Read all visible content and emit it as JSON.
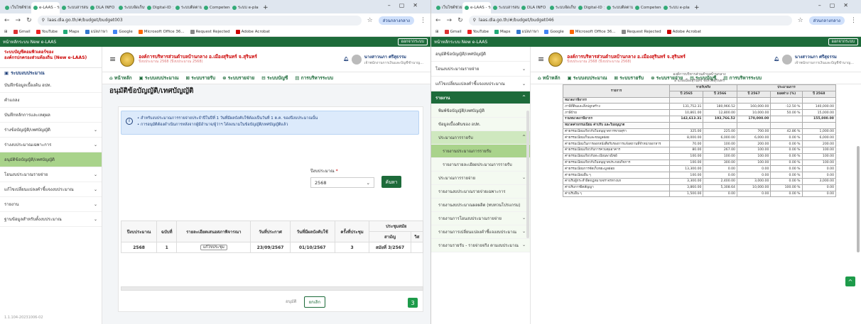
{
  "left": {
    "tabs": [
      "เว็บไซต์ช่วยใ",
      "e-LAAS - ระบบ",
      "ระบบสารสนเทศ",
      "DLA INFO",
      "ระบบจัดเก็บข้",
      "Digital-ID",
      "ระบบติดตามผล",
      "Competency",
      "ระบบ e-plan"
    ],
    "url": "laas.dla.go.th/#/budget/budget003",
    "profile": "ส่วนกลางกลาง",
    "bookmarks": [
      "Gmail",
      "YouTube",
      "Maps",
      "แปลภาษา",
      "Google",
      "Microsoft Office 36...",
      "Request Rejected",
      "Adobe Acrobat"
    ],
    "topbar_title": "หน้าหลักระบบ New e-LAAS",
    "logout": "ออกจากระบบ",
    "brand_line1": "ระบบบัญชีคอมพิวเตอร์ของ",
    "brand_line2": "องค์กรปกครองส่วนท้องถิ่น (New e-LAAS)",
    "menu_head": "ระบบงบประมาณ",
    "menu": [
      {
        "label": "บันทึกข้อมูลเบื้องต้น อปท.",
        "arrow": ""
      },
      {
        "label": "คำแถลง",
        "arrow": ""
      },
      {
        "label": "บันทึกหลักการและเหตุผล",
        "arrow": ""
      },
      {
        "label": "ร่างข้อบัญญัติ/เทศบัญญัติ",
        "arrow": "⌄"
      },
      {
        "label": "ร่างงบประมาณเฉพาะการ",
        "arrow": "⌄"
      },
      {
        "label": "อนุมัติข้อบัญญัติ/เทศบัญญัติ",
        "arrow": ""
      },
      {
        "label": "โอนงบประมาณรายจ่าย",
        "arrow": "⌄"
      },
      {
        "label": "แก้ไขเปลี่ยนแปลงคำชี้แจงงบประมาณ",
        "arrow": "⌄"
      },
      {
        "label": "รายงาน",
        "arrow": "⌄"
      },
      {
        "label": "ฐานข้อมูลสำหรับตั้งงบประมาณ",
        "arrow": "⌄"
      }
    ],
    "version": "1.1.104-20231006-02",
    "org_name": "องค์การบริหารส่วนตำบลบ้านกลาง อ.เมืองสุรินทร์ จ.สุรินทร์",
    "org_sub": "ปีงบประมาณ 2568 (ปีงบประมาณ 2568)",
    "user_name": "นางสาวนภา ศรีสุธรรม",
    "user_role": "เจ้าพนักงานการเงินและบัญชีชำนาญ...",
    "nav": [
      "หน้าหลัก",
      "ระบบงบประมาณ",
      "ระบบรายรับ",
      "ระบบรายจ่าย",
      "ระบบบัญชี",
      "การบริหารระบบ"
    ],
    "page_title": "อนุมัติข้อบัญญัติ/เทศบัญญัติ",
    "info1": "• สำหรับงบประมาณการรายจ่ายประจำปีในปีที่ 1 วันที่มีผลบังคับใช้ต้องเป็นวันที่ 1 ต.ค. ของปีงบประมาณนั้น",
    "info2": "• การอนุมัติต้องดำเนินการหลังจากผู้มีอำนาจ/ผู้ว่าฯ ได้ลงนามในข้อบัญญัติ/เทศบัญญัติแล้ว",
    "year_label": "ปีงบประมาณ",
    "year_req": "*",
    "year_value": "2568",
    "search_btn": "ค้นหา",
    "table_headers": [
      "ปีงบประมาณ",
      "ฉบับที่",
      "รายละเอียดเสนอสภาพิจารณา",
      "วันที่ประกาศ",
      "วันที่มีผลบังคับใช้",
      "ครั้งที่ประชุม",
      "ประชุมสมัย",
      "สามัญ",
      "วิส"
    ],
    "table_row": [
      "2568",
      "1",
      "แก้ไขประชุม",
      "23/09/2567",
      "01/10/2567",
      "3",
      "สมัยที่ 3/2567"
    ],
    "btn_approve": "อนุมัติ",
    "btn_cancel": "ยกเลิก"
  },
  "right": {
    "url": "laas.dla.go.th/#/budget/budget046",
    "menu_top": [
      {
        "label": "อนุมัติข้อบัญญัติ/เทศบัญญัติ",
        "arrow": ""
      },
      {
        "label": "โอนงบประมาณรายจ่าย",
        "arrow": "⌄"
      },
      {
        "label": "แก้ไขเปลี่ยนแปลงคำชี้แจงงบประมาณ",
        "arrow": "⌄"
      }
    ],
    "menu_report": "รายงาน",
    "sub": [
      {
        "label": "พิมพ์ข้อบัญญัติ/เทศบัญญัติ",
        "cls": "",
        "arrow": ""
      },
      {
        "label": "ข้อมูลเบื้องต้นของ อปท.",
        "cls": "",
        "arrow": ""
      },
      {
        "label": "ประมาณการรายรับ",
        "cls": "hl",
        "arrow": "^"
      },
      {
        "label": "รายงานประมาณการรายรับ",
        "cls": "sel",
        "arrow": ""
      },
      {
        "label": "รายงานรายละเอียดประมาณการรายรับ",
        "cls": "deep",
        "arrow": ""
      },
      {
        "label": "ประมาณการรายจ่าย",
        "cls": "",
        "arrow": "⌄"
      },
      {
        "label": "รายงานงบประมาณรายจ่ายเฉพาะการ",
        "cls": "",
        "arrow": ""
      },
      {
        "label": "รายงานงบประมาณผลผลิต (ทบทวนโปรแกรม)",
        "cls": "",
        "arrow": ""
      },
      {
        "label": "รายงานการโอนงบประมาณรายจ่าย",
        "cls": "",
        "arrow": "⌄"
      },
      {
        "label": "รายงานการเปลี่ยนแปลงคำชี้แจงงบประมาณ",
        "cls": "",
        "arrow": "⌄"
      },
      {
        "label": "รายงานรายรับ - รายจ่ายจริง ตามงบประมาณ",
        "cls": "",
        "arrow": "⌄"
      }
    ],
    "rep_head1": "องค์การบริหารส่วนตำบลบ้านกลาง",
    "rep_head2": "อำเภอเมืองสุรินทร์ จังหวัดสุรินทร์",
    "th_main": "รายการ",
    "th_group1": "รายรับจริง",
    "th_group2": "ประมาณการ",
    "th_cols": [
      "ปี 2565",
      "ปี 2566",
      "ปี 2567",
      "ยอดต่าง (%)",
      "ปี 2568"
    ],
    "rows": [
      {
        "t": "sec",
        "c": [
          "หมวดภาษีอากร",
          "",
          "",
          "",
          "",
          ""
        ]
      },
      {
        "t": "",
        "c": [
          "ภาษีที่ดินและสิ่งปลูกสร้าง",
          "131,752.31",
          "180,966.52",
          "160,000.00",
          "-12.50 %",
          "140,000.00"
        ]
      },
      {
        "t": "",
        "c": [
          "ภาษีป้าย",
          "10,861.00",
          "12,800.00",
          "10,000.00",
          "50.00 %",
          "15,000.00"
        ]
      },
      {
        "t": "tot",
        "c": [
          "รวมหมวดภาษีอากร",
          "142,613.31",
          "193,766.52",
          "170,000.00",
          "",
          "155,000.00"
        ]
      },
      {
        "t": "sec",
        "c": [
          "หมวดค่าธรรมเนียม ค่าปรับ และใบอนุญาต",
          "",
          "",
          "",
          "",
          ""
        ]
      },
      {
        "t": "",
        "c": [
          "ค่าธรรมเนียมเกี่ยวกับใบอนุญาตการขายสุรา",
          "325.00",
          "225.00",
          "700.00",
          "42.86 %",
          "1,000.00"
        ]
      },
      {
        "t": "",
        "c": [
          "ค่าธรรมเนียมเก็บและขนมูลฝอย",
          "8,000.00",
          "6,000.00",
          "6,000.00",
          "0.00 %",
          "6,000.00"
        ]
      },
      {
        "t": "",
        "c": [
          "ค่าธรรมเนียมในการออกหนังสือรับรองการแจ้งสถานที่จำหน่ายอาหาร",
          "70.00",
          "100.00",
          "200.00",
          "0.00 %",
          "200.00"
        ]
      },
      {
        "t": "",
        "c": [
          "ค่าธรรมเนียมเกี่ยวกับการควบคุมอาคาร",
          "80.00",
          "267.00",
          "100.00",
          "0.00 %",
          "100.00"
        ]
      },
      {
        "t": "",
        "c": [
          "ค่าธรรมเนียมเกี่ยวกับทะเบียนพาณิชย์",
          "100.00",
          "100.00",
          "100.00",
          "0.00 %",
          "100.00"
        ]
      },
      {
        "t": "",
        "c": [
          "ค่าธรรมเนียมเกี่ยวกับใบอนุญาตประกอบกิจการ",
          "100.00",
          "300.00",
          "100.00",
          "0.00 %",
          "100.00"
        ]
      },
      {
        "t": "",
        "c": [
          "ค่าธรรมเนียมการจัดเก็บขยะมูลฝอย",
          "13,300.00",
          "0.00",
          "0.00",
          "0.00 %",
          "0.00"
        ]
      },
      {
        "t": "",
        "c": [
          "ค่าธรรมเนียมอื่น ๆ",
          "100.00",
          "0.00",
          "0.00",
          "0.00 %",
          "0.00"
        ]
      },
      {
        "t": "",
        "c": [
          "ค่าปรับผู้กระทำผิดกฎหมายจราจรทางบก",
          "3,300.00",
          "2,400.00",
          "3,000.00",
          "0.00 %",
          "3,000.00"
        ]
      },
      {
        "t": "",
        "c": [
          "ค่าปรับการผิดสัญญา",
          "3,860.00",
          "5,308.64",
          "10,000.00",
          "100.00 %",
          "0.00"
        ]
      },
      {
        "t": "",
        "c": [
          "ค่าปรับอื่น ๆ",
          "1,500.00",
          "0.00",
          "0.00",
          "0.00 %",
          "0.00"
        ]
      }
    ]
  },
  "badge_up": "^"
}
